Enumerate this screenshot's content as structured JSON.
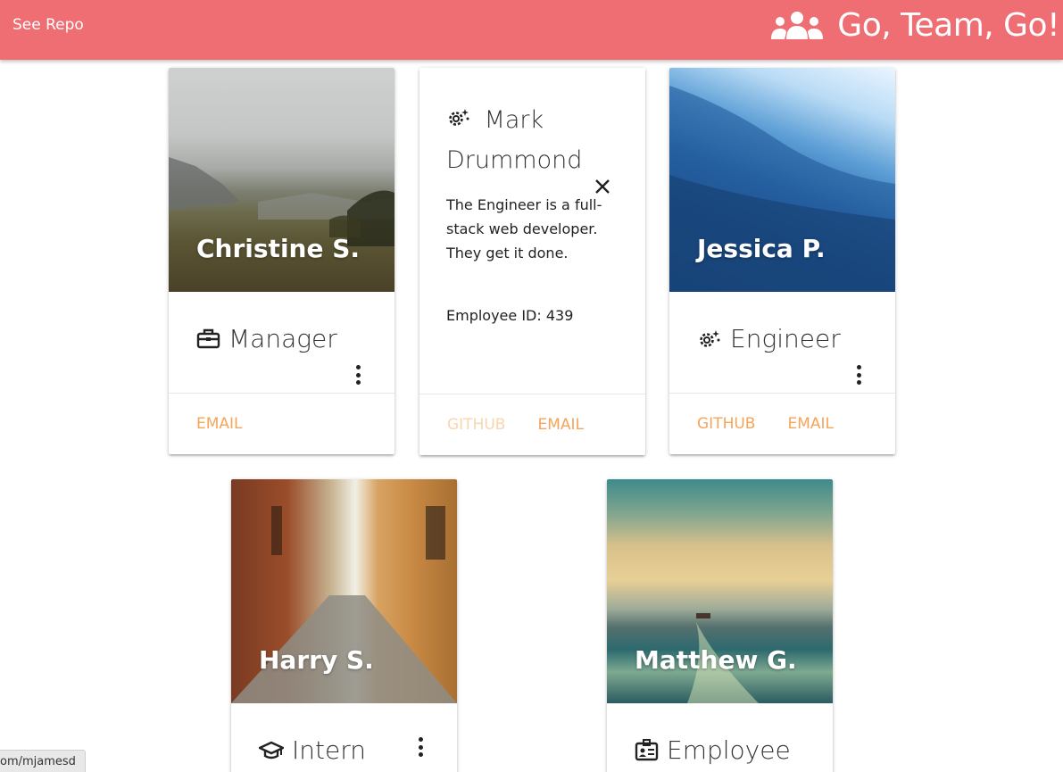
{
  "nav": {
    "link_label": "See Repo",
    "brand_title": "Go, Team, Go!",
    "brand_icon": "people-group-icon",
    "bg_color": "#ee6e73"
  },
  "accent_color": "#f5a55a",
  "cards": [
    {
      "name": "Christine S.",
      "role": "Manager",
      "role_icon": "briefcase-icon",
      "actions": [
        "EMAIL"
      ]
    },
    {
      "name": "Mark Drummond",
      "role": "Engineer",
      "role_icon": "cogs-icon",
      "reveal_open": true,
      "reveal_title": "Mark Drummond",
      "reveal_description": "The Engineer is a full-stack web developer. They get it done.",
      "reveal_id": "Employee ID: 439",
      "actions": [
        "GITHUB",
        "EMAIL"
      ]
    },
    {
      "name": "Jessica P.",
      "role": "Engineer",
      "role_icon": "cogs-icon",
      "actions": [
        "GITHUB",
        "EMAIL"
      ]
    },
    {
      "name": "Harry S.",
      "role": "Intern",
      "role_icon": "graduation-cap-icon",
      "actions": []
    },
    {
      "name": "Matthew G.",
      "role": "Employee",
      "role_icon": "id-card-icon",
      "actions": []
    }
  ],
  "status_bar": {
    "url_text": "om/mjamesd"
  }
}
